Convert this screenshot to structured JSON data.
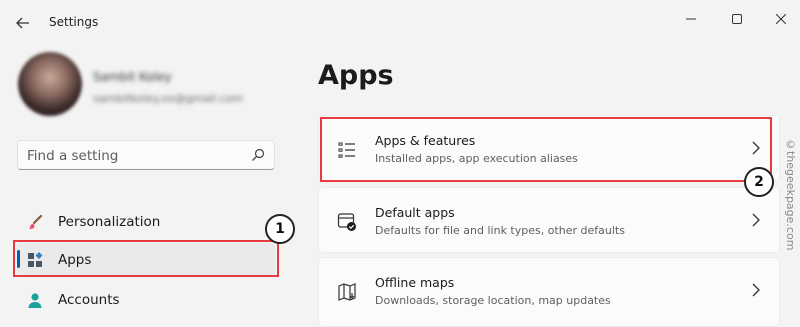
{
  "window": {
    "title": "Settings",
    "back_icon": "arrow-left-icon",
    "controls": [
      "minimize-icon",
      "maximize-icon",
      "close-icon"
    ]
  },
  "profile": {
    "name": "Sambit Koley",
    "email": "sambitkoley.xx@gmail.com",
    "blurred": true
  },
  "search": {
    "placeholder": "Find a setting",
    "icon": "search-icon"
  },
  "sidebar": {
    "items": [
      {
        "label": "Personalization",
        "icon": "paint-brush-icon",
        "selected": false
      },
      {
        "label": "Apps",
        "icon": "apps-icon",
        "selected": true
      },
      {
        "label": "Accounts",
        "icon": "person-icon",
        "selected": false
      }
    ]
  },
  "main": {
    "title": "Apps",
    "cards": [
      {
        "title": "Apps & features",
        "description": "Installed apps, app execution aliases",
        "icon": "list-icon"
      },
      {
        "title": "Default apps",
        "description": "Defaults for file and link types, other defaults",
        "icon": "default-apps-icon"
      },
      {
        "title": "Offline maps",
        "description": "Downloads, storage location, map updates",
        "icon": "map-icon"
      }
    ]
  },
  "annotations": {
    "step1": "1",
    "step2": "2",
    "highlight_color": "#e83a40"
  },
  "watermark": "©thegeekpage.com",
  "colors": {
    "accent": "#005fb8",
    "background": "#f3f3f3",
    "card": "#fbfbfb"
  }
}
